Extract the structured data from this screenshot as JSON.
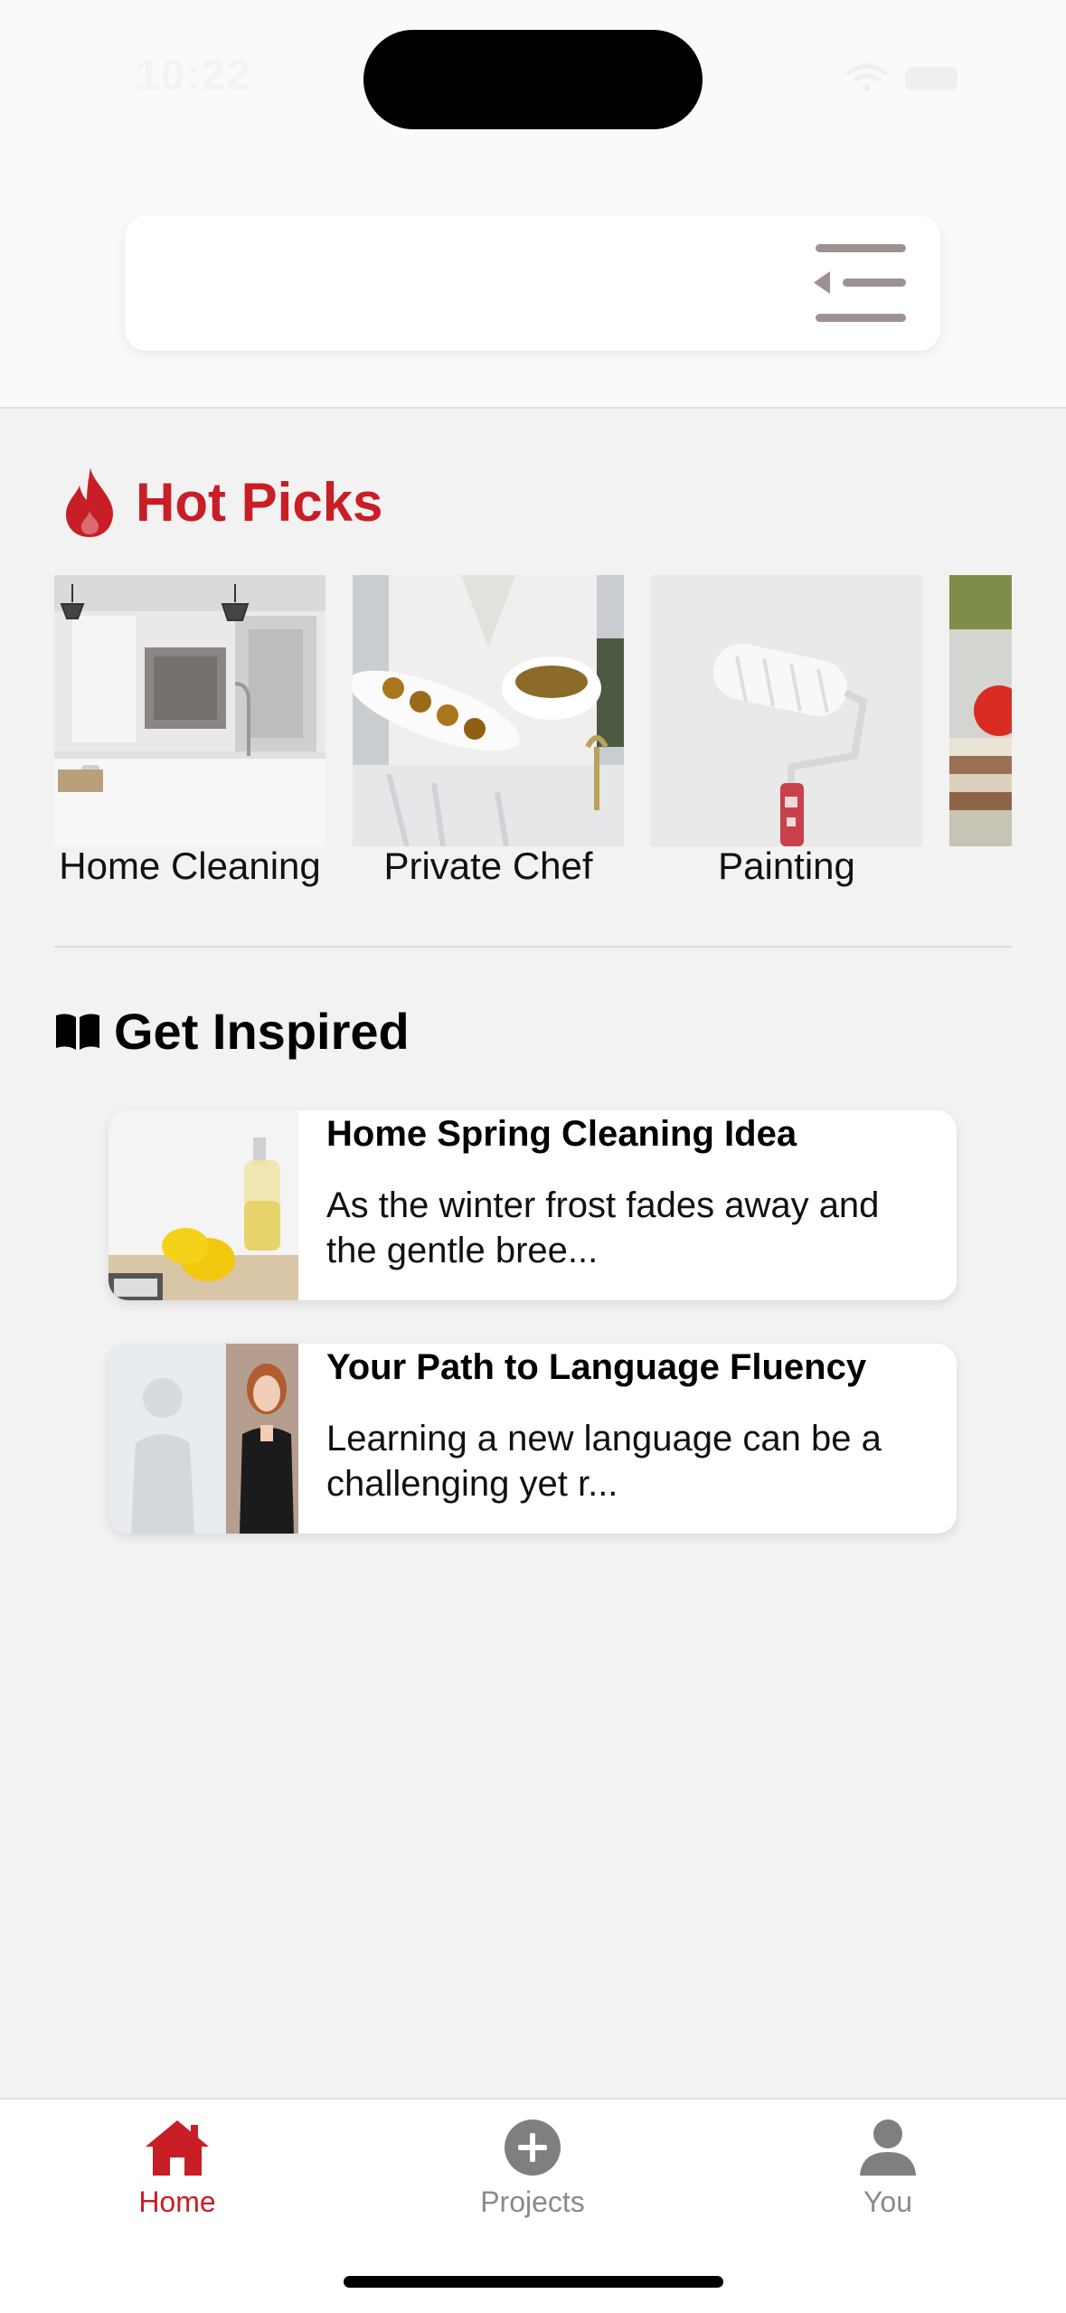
{
  "status_bar": {
    "time": "10:22"
  },
  "hot_picks": {
    "title": "Hot Picks",
    "items": [
      {
        "label": "Home Cleaning"
      },
      {
        "label": "Private Chef"
      },
      {
        "label": "Painting"
      },
      {
        "label": ""
      }
    ]
  },
  "get_inspired": {
    "title": "Get Inspired",
    "articles": [
      {
        "title": "Home Spring Cleaning Idea",
        "excerpt": "As the winter frost fades away and the gentle bree..."
      },
      {
        "title": "Your Path to Language Fluency",
        "excerpt": "Learning a new language can be a challenging yet r..."
      }
    ]
  },
  "tabbar": {
    "home": "Home",
    "projects": "Projects",
    "you": "You"
  },
  "colors": {
    "accent": "#c81e25",
    "inactive": "#8a8a8a",
    "background": "#f2f2f2"
  }
}
